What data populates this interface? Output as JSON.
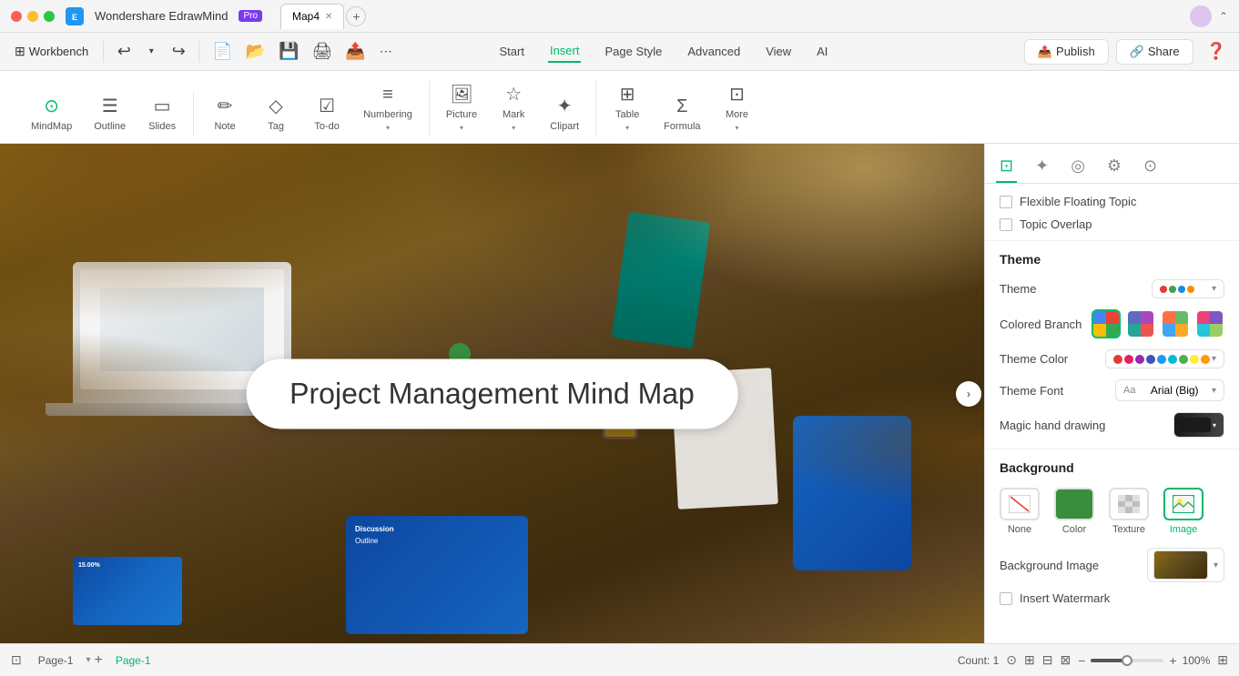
{
  "app": {
    "name": "Wondershare EdrawMind",
    "badge": "Pro",
    "tab_name": "Map4",
    "window_title": "Map4"
  },
  "title_bar": {
    "workbench": "Workbench",
    "collapse_icon": "⌃"
  },
  "menu_bar": {
    "tabs": [
      "Start",
      "Insert",
      "Page Style",
      "Advanced",
      "View",
      "AI"
    ],
    "active_tab": "Insert",
    "publish_label": "Publish",
    "share_label": "Share"
  },
  "ribbon": {
    "left_group": [
      {
        "id": "mindmap",
        "label": "MindMap",
        "icon": "✦"
      },
      {
        "id": "outline",
        "label": "Outline",
        "icon": "☰"
      },
      {
        "id": "slides",
        "label": "Slides",
        "icon": "▭"
      }
    ],
    "items": [
      {
        "id": "note",
        "label": "Note",
        "icon": "✏"
      },
      {
        "id": "tag",
        "label": "Tag",
        "icon": "◇"
      },
      {
        "id": "todo",
        "label": "To-do",
        "icon": "☑"
      },
      {
        "id": "numbering",
        "label": "Numbering",
        "icon": "≡"
      },
      {
        "id": "picture",
        "label": "Picture",
        "icon": "🖼"
      },
      {
        "id": "mark",
        "label": "Mark",
        "icon": "☆"
      },
      {
        "id": "clipart",
        "label": "Clipart",
        "icon": "✦"
      },
      {
        "id": "table",
        "label": "Table",
        "icon": "⊞"
      },
      {
        "id": "formula",
        "label": "Formula",
        "icon": "Σ"
      },
      {
        "id": "more",
        "label": "More",
        "icon": "⊡"
      }
    ]
  },
  "canvas": {
    "title": "Project Management Mind Map"
  },
  "right_panel": {
    "tabs": [
      {
        "id": "style",
        "icon": "⊡",
        "active": true
      },
      {
        "id": "ai",
        "icon": "✦"
      },
      {
        "id": "search",
        "icon": "◎"
      },
      {
        "id": "settings",
        "icon": "⚙"
      },
      {
        "id": "time",
        "icon": "⊙"
      }
    ],
    "checkboxes": [
      {
        "id": "floating",
        "label": "Flexible Floating Topic"
      },
      {
        "id": "overlap",
        "label": "Topic Overlap"
      }
    ],
    "theme_section_label": "Theme",
    "theme_label": "Theme",
    "theme_preview_dots": [
      "#e53935",
      "#43A047",
      "#1E88E5",
      "#FB8C00"
    ],
    "colored_branch_label": "Colored Branch",
    "theme_color_label": "Theme Color",
    "theme_colors": [
      "#e53935",
      "#e91e63",
      "#9c27b0",
      "#3f51b5",
      "#2196f3",
      "#00bcd4",
      "#4caf50",
      "#ffeb3b",
      "#ff9800"
    ],
    "theme_font_label": "Theme Font",
    "theme_font_value": "Arial (Big)",
    "magic_hand_label": "Magic hand drawing",
    "background_section_label": "Background",
    "bg_options": [
      {
        "id": "none",
        "label": "None",
        "icon": "✕"
      },
      {
        "id": "color",
        "label": "Color",
        "icon": "▪"
      },
      {
        "id": "texture",
        "label": "Texture",
        "icon": "▦"
      },
      {
        "id": "image",
        "label": "Image",
        "icon": "🖼",
        "active": true
      }
    ],
    "bg_image_label": "Background Image",
    "watermark_label": "Insert Watermark"
  },
  "status_bar": {
    "page_label": "Page-1",
    "active_page": "Page-1",
    "count_label": "Count: 1",
    "zoom_level": "100%",
    "add_page": "+"
  }
}
